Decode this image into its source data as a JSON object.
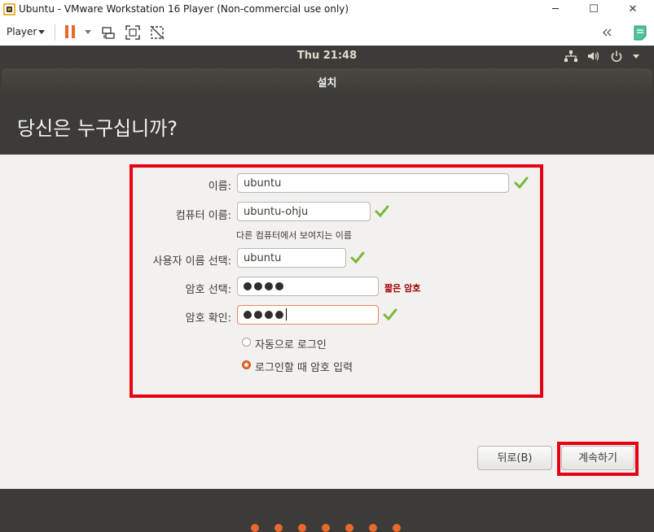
{
  "window": {
    "title": "Ubuntu - VMware Workstation 16 Player (Non-commercial use only)",
    "minimize_glyph": "─",
    "maximize_glyph": "☐",
    "close_glyph": "✕"
  },
  "toolbar": {
    "player_label": "Player",
    "icons": [
      "pause-icon",
      "send-ctrl-alt-del-icon",
      "fit-guest-icon",
      "unity-icon",
      "collapse-toolbar-icon",
      "message-log-icon"
    ]
  },
  "ubuntu_panel": {
    "clock": "Thu 21:48",
    "icons": [
      "network-icon",
      "volume-icon",
      "power-icon"
    ]
  },
  "installer": {
    "dialog_title": "설치",
    "heading": "당신은 누구십니까?",
    "fields": {
      "name_label": "이름:",
      "name_value": "ubuntu",
      "computer_label": "컴퓨터 이름:",
      "computer_value": "ubuntu-ohju",
      "computer_hint": "다른 컴퓨터에서 보여지는 이름",
      "username_label": "사용자 이름 선택:",
      "username_value": "ubuntu",
      "password_label": "암호 선택:",
      "password_masked_count": 4,
      "password_strength": "짧은 암호",
      "confirm_label": "암호 확인:",
      "confirm_masked_count": 4
    },
    "login_options": {
      "auto_login": "자동으로 로그인",
      "require_password": "로그인할 때 암호 입력",
      "selected": "require_password"
    },
    "buttons": {
      "back": "뒤로(B)",
      "continue": "계속하기"
    },
    "progress": {
      "total_steps": 7
    },
    "colors": {
      "accent": "#e9692c",
      "highlight": "#e60012",
      "panel": "#3c3b37",
      "check": "#7ab839",
      "warning": "#a40000"
    }
  }
}
